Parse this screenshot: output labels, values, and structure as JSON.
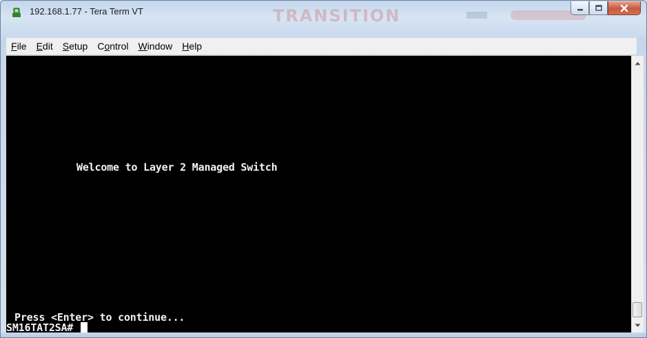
{
  "window": {
    "title": "192.168.1.77 - Tera Term VT",
    "watermark": "TRANSITION"
  },
  "menu": [
    {
      "accel": "F",
      "rest": "ile"
    },
    {
      "accel": "E",
      "rest": "dit"
    },
    {
      "accel": "S",
      "rest": "etup"
    },
    {
      "prefix": "C",
      "accel": "o",
      "rest": "ntrol"
    },
    {
      "accel": "W",
      "rest": "indow"
    },
    {
      "accel": "H",
      "rest": "elp"
    }
  ],
  "terminal": {
    "welcome": "Welcome to Layer 2 Managed Switch",
    "press": "Press <Enter> to continue...",
    "prompt": "SM16TAT2SA# "
  },
  "colors": {
    "terminal_bg": "#000000",
    "terminal_fg": "#f3f3f3",
    "close_button": "#c75a3f"
  },
  "icons": {
    "app": "tera-term-icon",
    "minimize": "minimize-icon",
    "maximize": "maximize-icon",
    "close": "close-icon",
    "scroll_up": "arrow-up-icon",
    "scroll_down": "arrow-down-icon"
  }
}
